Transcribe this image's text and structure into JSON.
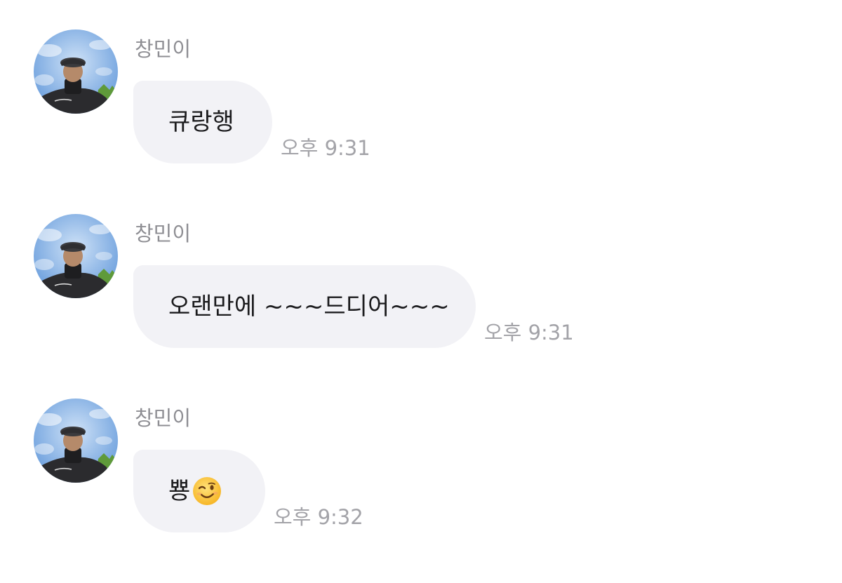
{
  "messages": [
    {
      "sender": "창민이",
      "text": "큐랑행",
      "time": "오후 9:31"
    },
    {
      "sender": "창민이",
      "text": "오랜만에 ~~~드디어~~~",
      "time": "오후 9:31"
    },
    {
      "sender": "창민이",
      "text": "뿅",
      "emoji": "winking-face-emoji",
      "time": "오후 9:32"
    }
  ],
  "colors": {
    "bubble": "#f2f2f6",
    "sender_text": "#8e8e93",
    "time_text": "#a3a3a8",
    "message_text": "#1c1c1e"
  }
}
